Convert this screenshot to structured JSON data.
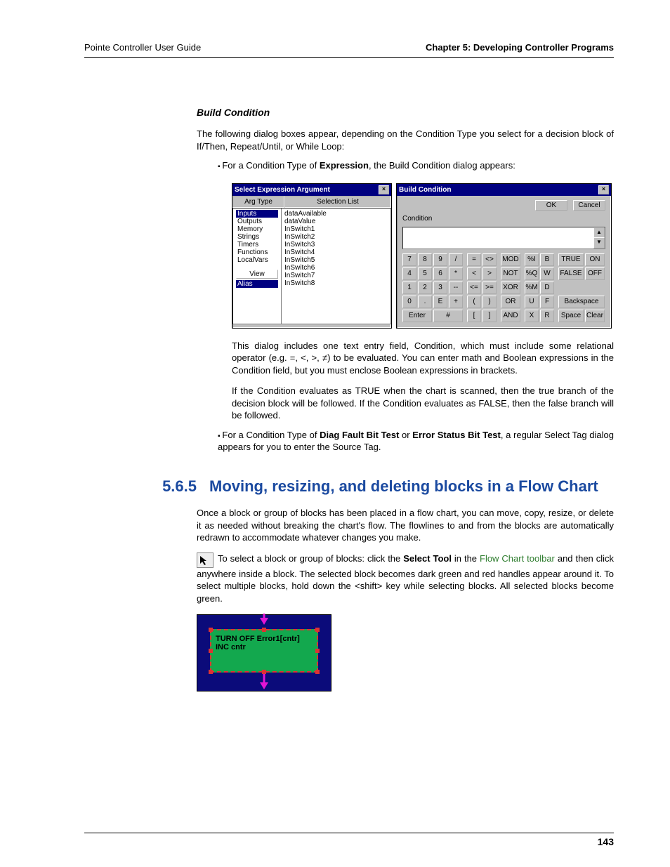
{
  "header": {
    "left": "Pointe Controller User Guide",
    "right": "Chapter 5: Developing Controller Programs"
  },
  "sub_heading": "Build Condition",
  "para1": "The following dialog boxes appear, depending on the Condition Type you select for a decision block of If/Then, Repeat/Until, or While Loop:",
  "bullet1_pre": "For a Condition Type of ",
  "bullet1_bold": "Expression",
  "bullet1_post": ", the Build Condition dialog appears:",
  "sea": {
    "title": "Select Expression Argument",
    "col_hdrs": [
      "Arg Type",
      "Selection List"
    ],
    "types_sel": "Inputs",
    "types": [
      "Outputs",
      "Memory",
      "Strings",
      "Timers",
      "Functions",
      "LocalVars"
    ],
    "view": "View",
    "alias": "Alias",
    "items": [
      "dataAvailable",
      "dataValue",
      "InSwitch1",
      "InSwitch2",
      "InSwitch3",
      "InSwitch4",
      "InSwitch5",
      "InSwitch6",
      "InSwitch7",
      "InSwitch8"
    ]
  },
  "bc": {
    "title": "Build Condition",
    "ok": "OK",
    "cancel": "Cancel",
    "label": "Condition",
    "numpad": [
      "7",
      "8",
      "9",
      "/",
      "4",
      "5",
      "6",
      "*",
      "1",
      "2",
      "3",
      "--",
      "0",
      ".",
      "E",
      "+"
    ],
    "enter": "Enter",
    "hash": "#",
    "rel": [
      "=",
      "<>",
      "<",
      ">",
      "<=",
      ">="
    ],
    "paren": [
      "(",
      ")",
      "[",
      "]"
    ],
    "logic": [
      "MOD",
      "NOT",
      "XOR",
      "OR",
      "AND"
    ],
    "pct": [
      "%I",
      "%Q",
      "%M",
      "U",
      "X"
    ],
    "letters": [
      "B",
      "W",
      "D",
      "F",
      "R"
    ],
    "col5": [
      "TRUE",
      "ON",
      "FALSE",
      "OFF"
    ],
    "backspace": "Backspace",
    "space": "Space",
    "clear": "Clear"
  },
  "para2": "This dialog includes one text entry field, Condition, which must include some relational operator (e.g. =, <, >, ≠) to be evaluated. You can enter math and Boolean expressions in the Condition field, but you must enclose Boolean expressions in brackets.",
  "para3": "If the Condition evaluates as TRUE when the chart is scanned, then the true branch of the decision block will be followed. If the Condition evaluates as FALSE, then the false branch will be followed.",
  "bullet2_pre": "For a Condition Type of ",
  "bullet2_b1": "Diag Fault Bit Test",
  "bullet2_mid": " or ",
  "bullet2_b2": "Error Status Bit Test",
  "bullet2_post": ", a regular Select Tag dialog appears for you to enter the Source Tag.",
  "h2_num": "5.6.5",
  "h2_txt": "Moving, resizing, and deleting blocks in a Flow Chart",
  "para4": "Once a block or group of blocks has been placed in a flow chart, you can move, copy, resize, or delete it as needed without breaking the chart's flow. The flowlines to and from the blocks are automatically redrawn to accommodate whatever changes you make.",
  "para5_a": "To select a block or group of blocks: click the ",
  "para5_b": "Select Tool",
  "para5_c": " in the ",
  "para5_link1": "Flow Chart toolbar",
  "para5_d": " and then click anywhere inside a block. The selected block becomes dark green and red handles appear around it. To select multiple blocks, hold down  the <shift> key while selecting blocks.  All selected blocks become green.",
  "block": {
    "line1": "TURN OFF Error1[cntr]",
    "line2": "INC cntr"
  },
  "page_number": "143"
}
